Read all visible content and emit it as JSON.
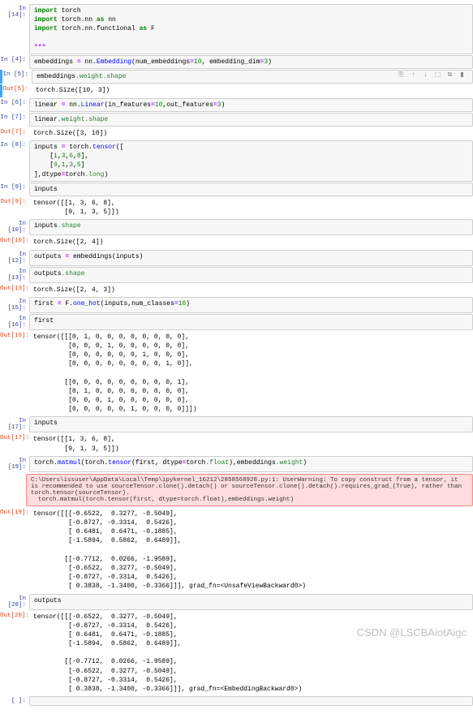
{
  "cells": [
    {
      "n": "14",
      "type": "in",
      "code": true,
      "lines": [
        [
          {
            "t": "import ",
            "c": "k-kw"
          },
          {
            "t": "torch"
          }
        ],
        [
          {
            "t": "import ",
            "c": "k-kw"
          },
          {
            "t": "torch.nn "
          },
          {
            "t": "as ",
            "c": "k-as"
          },
          {
            "t": "nn"
          }
        ],
        [
          {
            "t": "import ",
            "c": "k-kw"
          },
          {
            "t": "torch.nn.functional "
          },
          {
            "t": "as ",
            "c": "k-as"
          },
          {
            "t": "F"
          }
        ],
        [
          {
            "t": ""
          }
        ],
        [
          {
            "t": "***",
            "c": "k-op"
          }
        ]
      ]
    },
    {
      "n": "4",
      "type": "in",
      "code": true,
      "lines": [
        [
          {
            "t": "embeddings "
          },
          {
            "t": "= ",
            "c": "k-op"
          },
          {
            "t": "nn"
          },
          {
            "t": "."
          },
          {
            "t": "Embedding",
            "c": "k-fn"
          },
          {
            "t": "(num_embeddings"
          },
          {
            "t": "=",
            "c": "k-op"
          },
          {
            "t": "10",
            "c": "k-num"
          },
          {
            "t": ", embedding_dim"
          },
          {
            "t": "=",
            "c": "k-op"
          },
          {
            "t": "3",
            "c": "k-num"
          },
          {
            "t": ")"
          }
        ]
      ]
    },
    {
      "n": "5",
      "type": "in",
      "code": true,
      "selected": true,
      "toolbar": true,
      "lines": [
        [
          {
            "t": "embeddings"
          },
          {
            "t": ".weight",
            "c": "k-attr"
          },
          {
            "t": ".shape",
            "c": "k-attr"
          }
        ]
      ]
    },
    {
      "n": "5",
      "type": "out",
      "lines": [
        [
          {
            "t": "torch.Size([10, 3])"
          }
        ]
      ],
      "selected": true
    },
    {
      "n": "6",
      "type": "in",
      "code": true,
      "lines": [
        [
          {
            "t": "linear "
          },
          {
            "t": "= ",
            "c": "k-op"
          },
          {
            "t": "nn"
          },
          {
            "t": "."
          },
          {
            "t": "Linear",
            "c": "k-fn"
          },
          {
            "t": "(in_features"
          },
          {
            "t": "=",
            "c": "k-op"
          },
          {
            "t": "10",
            "c": "k-num"
          },
          {
            "t": ",out_features"
          },
          {
            "t": "=",
            "c": "k-op"
          },
          {
            "t": "3",
            "c": "k-num"
          },
          {
            "t": ")"
          }
        ]
      ]
    },
    {
      "n": "7",
      "type": "in",
      "code": true,
      "lines": [
        [
          {
            "t": "linear"
          },
          {
            "t": ".weight",
            "c": "k-attr"
          },
          {
            "t": ".shape",
            "c": "k-attr"
          }
        ]
      ]
    },
    {
      "n": "7",
      "type": "out",
      "lines": [
        [
          {
            "t": "torch.Size([3, 10])"
          }
        ]
      ]
    },
    {
      "n": "8",
      "type": "in",
      "code": true,
      "lines": [
        [
          {
            "t": "inputs "
          },
          {
            "t": "= ",
            "c": "k-op"
          },
          {
            "t": "torch"
          },
          {
            "t": "."
          },
          {
            "t": "tensor",
            "c": "k-fn"
          },
          {
            "t": "(["
          }
        ],
        [
          {
            "t": "    ["
          },
          {
            "t": "1",
            "c": "k-num"
          },
          {
            "t": ","
          },
          {
            "t": "3",
            "c": "k-num"
          },
          {
            "t": ","
          },
          {
            "t": "6",
            "c": "k-attr"
          },
          {
            "t": ","
          },
          {
            "t": "8",
            "c": "k-num"
          },
          {
            "t": "],"
          }
        ],
        [
          {
            "t": "    ["
          },
          {
            "t": "9",
            "c": "k-attr"
          },
          {
            "t": ","
          },
          {
            "t": "1",
            "c": "k-num"
          },
          {
            "t": ","
          },
          {
            "t": "3",
            "c": "k-attr"
          },
          {
            "t": ","
          },
          {
            "t": "5",
            "c": "k-num"
          },
          {
            "t": "]"
          }
        ],
        [
          {
            "t": "],dtype"
          },
          {
            "t": "=",
            "c": "k-op"
          },
          {
            "t": "torch"
          },
          {
            "t": ".long",
            "c": "k-attr"
          },
          {
            "t": ")"
          }
        ]
      ]
    },
    {
      "n": "9",
      "type": "in",
      "code": true,
      "lines": [
        [
          {
            "t": "inputs"
          }
        ]
      ]
    },
    {
      "n": "9",
      "type": "out",
      "lines": [
        [
          {
            "t": "tensor([[1, 3, 6, 8],"
          }
        ],
        [
          {
            "t": "        [9, 1, 3, 5]])"
          }
        ]
      ]
    },
    {
      "n": "10",
      "type": "in",
      "code": true,
      "lines": [
        [
          {
            "t": "inputs"
          },
          {
            "t": ".shape",
            "c": "k-attr"
          }
        ]
      ]
    },
    {
      "n": "10",
      "type": "out",
      "lines": [
        [
          {
            "t": "torch.Size([2, 4])"
          }
        ]
      ]
    },
    {
      "n": "12",
      "type": "in",
      "code": true,
      "lines": [
        [
          {
            "t": "outputs "
          },
          {
            "t": "= ",
            "c": "k-op"
          },
          {
            "t": "embeddings(inputs)"
          }
        ]
      ]
    },
    {
      "n": "13",
      "type": "in",
      "code": true,
      "lines": [
        [
          {
            "t": "outputs"
          },
          {
            "t": ".shape",
            "c": "k-attr"
          }
        ]
      ]
    },
    {
      "n": "13",
      "type": "out",
      "lines": [
        [
          {
            "t": "torch.Size([2, 4, 3])"
          }
        ]
      ]
    },
    {
      "n": "15",
      "type": "in",
      "code": true,
      "lines": [
        [
          {
            "t": "first "
          },
          {
            "t": "= ",
            "c": "k-op"
          },
          {
            "t": "F"
          },
          {
            "t": "."
          },
          {
            "t": "one_hot",
            "c": "k-fn"
          },
          {
            "t": "(inputs,num_classes"
          },
          {
            "t": "=",
            "c": "k-op"
          },
          {
            "t": "10",
            "c": "k-num"
          },
          {
            "t": ")"
          }
        ]
      ]
    },
    {
      "n": "16",
      "type": "in",
      "code": true,
      "lines": [
        [
          {
            "t": "first"
          }
        ]
      ]
    },
    {
      "n": "16",
      "type": "out",
      "lines": [
        [
          {
            "t": "tensor([[[0, 1, 0, 0, 0, 0, 0, 0, 0, 0],"
          }
        ],
        [
          {
            "t": "         [0, 0, 0, 1, 0, 0, 0, 0, 0, 0],"
          }
        ],
        [
          {
            "t": "         [0, 0, 0, 0, 0, 0, 1, 0, 0, 0],"
          }
        ],
        [
          {
            "t": "         [0, 0, 0, 0, 0, 0, 0, 0, 1, 0]],"
          }
        ],
        [
          {
            "t": ""
          }
        ],
        [
          {
            "t": "        [[0, 0, 0, 0, 0, 0, 0, 0, 0, 1],"
          }
        ],
        [
          {
            "t": "         [0, 1, 0, 0, 0, 0, 0, 0, 0, 0],"
          }
        ],
        [
          {
            "t": "         [0, 0, 0, 1, 0, 0, 0, 0, 0, 0],"
          }
        ],
        [
          {
            "t": "         [0, 0, 0, 0, 0, 1, 0, 0, 0, 0]]])"
          }
        ]
      ]
    },
    {
      "n": "17",
      "type": "in",
      "code": true,
      "lines": [
        [
          {
            "t": "inputs"
          }
        ]
      ]
    },
    {
      "n": "17",
      "type": "out",
      "lines": [
        [
          {
            "t": "tensor([[1, 3, 6, 8],"
          }
        ],
        [
          {
            "t": "        [9, 1, 3, 5]])"
          }
        ]
      ]
    },
    {
      "n": "19",
      "type": "in",
      "code": true,
      "lines": [
        [
          {
            "t": "torch"
          },
          {
            "t": "."
          },
          {
            "t": "matmul",
            "c": "k-fn"
          },
          {
            "t": "(torch"
          },
          {
            "t": "."
          },
          {
            "t": "tensor",
            "c": "k-fn"
          },
          {
            "t": "(first, dtype"
          },
          {
            "t": "=",
            "c": "k-op"
          },
          {
            "t": "torch"
          },
          {
            "t": ".float",
            "c": "k-attr"
          },
          {
            "t": "),embeddings"
          },
          {
            "t": ".weight",
            "c": "k-attr"
          },
          {
            "t": ")"
          }
        ]
      ]
    },
    {
      "n": "warn",
      "type": "warn",
      "text": "C:\\Users\\issuser\\AppData\\Local\\Temp\\ipykernel_16212\\2858568928.py:1: UserWarning: To copy construct from a tensor, it is recommended to use sourceTensor.clone().detach() or sourceTensor.clone().detach().requires_grad_(True), rather than torch.tensor(sourceTensor).\n  torch.matmul(torch.tensor(first, dtype=torch.float),embeddings.weight)"
    },
    {
      "n": "19",
      "type": "out",
      "lines": [
        [
          {
            "t": "tensor([[[-0.6522,  0.3277, -0.5049],"
          }
        ],
        [
          {
            "t": "         [-0.8727, -0.3314,  0.5426],"
          }
        ],
        [
          {
            "t": "         [ 0.6481,  0.6471, -0.1885],"
          }
        ],
        [
          {
            "t": "         [-1.5894,  0.5862,  0.6489]],"
          }
        ],
        [
          {
            "t": ""
          }
        ],
        [
          {
            "t": "        [[-0.7712,  0.0266, -1.9589],"
          }
        ],
        [
          {
            "t": "         [-0.6522,  0.3277, -0.5049],"
          }
        ],
        [
          {
            "t": "         [-0.8727, -0.3314,  0.5426],"
          }
        ],
        [
          {
            "t": "         [ 0.3838, -1.3400, -0.3366]]], grad_fn=<UnsafeViewBackward0>)"
          }
        ]
      ]
    },
    {
      "n": "20",
      "type": "in",
      "code": true,
      "lines": [
        [
          {
            "t": "outputs"
          }
        ]
      ]
    },
    {
      "n": "20",
      "type": "out",
      "lines": [
        [
          {
            "t": "tensor([[[-0.6522,  0.3277, -0.5049],"
          }
        ],
        [
          {
            "t": "         [-0.8727, -0.3314,  0.5426],"
          }
        ],
        [
          {
            "t": "         [ 0.6481,  0.6471, -0.1885],"
          }
        ],
        [
          {
            "t": "         [-1.5894,  0.5862,  0.6489]],"
          }
        ],
        [
          {
            "t": ""
          }
        ],
        [
          {
            "t": "        [[-0.7712,  0.0266, -1.9589],"
          }
        ],
        [
          {
            "t": "         [-0.6522,  0.3277, -0.5049],"
          }
        ],
        [
          {
            "t": "         [-0.8727, -0.3314,  0.5426],"
          }
        ],
        [
          {
            "t": "         [ 0.3838, -1.3400, -0.3366]]], grad_fn=<EmbeddingBackward0>)"
          }
        ]
      ]
    },
    {
      "n": "",
      "type": "in",
      "code": true,
      "lines": [
        [
          {
            "t": ""
          }
        ]
      ]
    }
  ],
  "toolbar": {
    "icons": [
      "⎘",
      "↑",
      "↓",
      "⬚",
      "⧉",
      "▮"
    ]
  },
  "watermark": "CSDN @LSCBAiotAigc",
  "prompt_in": "In [%]:",
  "prompt_out": "Out[%]:"
}
